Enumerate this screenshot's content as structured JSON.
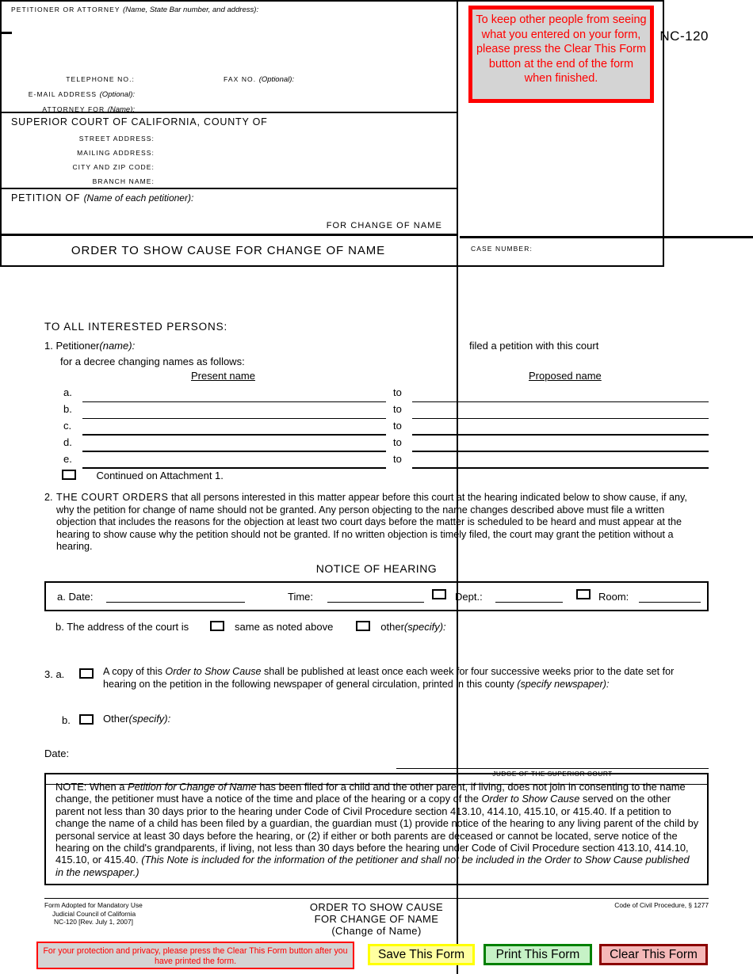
{
  "form_number": "NC-120",
  "caption": {
    "attorney_label": "PETITIONER OR ATTORNEY",
    "attorney_hint": "(Name, State Bar number, and address):",
    "telephone_label": "TELEPHONE NO.:",
    "fax_label": "FAX NO.",
    "fax_hint": "(Optional):",
    "email_label": "E-MAIL ADDRESS",
    "email_hint": "(Optional):",
    "attorney_for_label": "ATTORNEY FOR",
    "attorney_for_hint": "(Name):",
    "court_title": "SUPERIOR COURT OF CALIFORNIA, COUNTY OF",
    "street_label": "STREET ADDRESS:",
    "mailing_label": "MAILING ADDRESS:",
    "city_zip_label": "CITY AND ZIP CODE:",
    "branch_label": "BRANCH NAME:",
    "petition_of_label": "PETITION OF",
    "petition_of_hint": "(Name of each petitioner):",
    "for_change_of_name": "FOR CHANGE OF NAME",
    "form_title": "ORDER TO SHOW CAUSE FOR CHANGE OF NAME",
    "case_number_label": "CASE NUMBER:"
  },
  "privacy_notice": {
    "text": "To keep other people from seeing what you entered on your form, please press the Clear This Form button at the end of the form when finished.",
    "text_color": "#ff0000",
    "border_color": "#ff0000",
    "background_color": "#d4d4d4"
  },
  "body": {
    "to_all_interested": "TO ALL INTERESTED PERSONS:",
    "item1_number": "1.",
    "item1_petitioner": "Petitioner",
    "item1_petitioner_hint": "(name):",
    "item1_filed": "filed a petition with this court",
    "item1_decree": "for a decree changing names as follows:",
    "present_name_header": "Present name",
    "proposed_name_header": "Proposed name",
    "name_rows": [
      "a.",
      "b.",
      "c.",
      "d.",
      "e."
    ],
    "to_label": "to",
    "continued_label": "Continued on Attachment 1.",
    "item2_number": "2.",
    "item2_bold": "THE COURT ORDERS",
    "item2_text": " that all persons interested in this matter appear before this court at the hearing indicated below to show cause, if any, why the petition for change of name should not be granted. Any person objecting to the name changes described above must file a written objection that includes the reasons for the objection at least two court days before the matter is scheduled to be heard and must appear at the hearing to show cause why the petition should not be granted.  If no written objection is timely filed, the court may grant the petition without a hearing.",
    "notice_of_hearing": "NOTICE OF HEARING",
    "hearing_a": "a. Date:",
    "hearing_time": "Time:",
    "hearing_dept": "Dept.:",
    "hearing_room": "Room:",
    "hearing_b": "b. The address of the court is",
    "hearing_b_same": "same as noted above",
    "hearing_b_other": "other",
    "hearing_b_other_hint": "(specify):",
    "item3_number": "3. a.",
    "item3a_pre": "A copy of this ",
    "item3a_italic": "Order to Show Cause",
    "item3a_post": " shall be published at least once each week for four successive weeks prior to the date set for hearing on the petition in the following newspaper of general circulation, printed in this county ",
    "item3a_hint": "(specify newspaper):",
    "item3b_letter": "b.",
    "item3b_text": "Other",
    "item3b_hint": "(specify):",
    "date_label": "Date:",
    "judge_label": "JUDGE OF THE SUPERIOR COURT"
  },
  "note": {
    "prefix": "NOTE: When a ",
    "italic1": "Petition for Change of Name",
    "text1": " has been filed for a child and the other parent, if living, does not join in consenting to the name change, the petitioner must have a notice of the time and place of the hearing or a copy of the ",
    "italic2": "Order to Show Cause",
    "text2": " served on the other parent not less than 30 days prior to the hearing under Code of Civil Procedure section 413.10, 414.10, 415.10, or 415.40. If a petition to change the name of a child has been filed by a guardian, the guardian must (1) provide notice of the hearing to any living parent of the child by personal service at least 30 days before the hearing, or (2) if either or both parents are deceased or cannot be located, serve notice of the hearing on the child's grandparents, if living, not less than 30 days before the hearing under Code of Civil Procedure section 413.10, 414.10, 415.10, or 415.40. ",
    "italic3": "(This Note is included for the information of the petitioner and shall not be included in the Order to Show Cause published in the newspaper.)"
  },
  "footer": {
    "adopted_line1": "Form Adopted for Mandatory Use",
    "adopted_line2": "Judicial Council of California",
    "adopted_line3": "NC-120 [Rev. July 1, 2007]",
    "title_line1": "ORDER TO SHOW CAUSE",
    "title_line2": "FOR CHANGE OF NAME",
    "title_line3": "(Change of Name)",
    "code_ref": "Code of Civil Procedure, § 1277"
  },
  "toolbar": {
    "warning_text": "For your protection and privacy, please press the Clear This Form button after you have printed the form.",
    "warning_color": "#ff0000",
    "save_label": "Save This Form",
    "print_label": "Print This Form",
    "clear_label": "Clear This Form",
    "save_bg": "#ffffa0",
    "print_bg": "#c6f2c6",
    "clear_bg": "#f5b8b8"
  }
}
